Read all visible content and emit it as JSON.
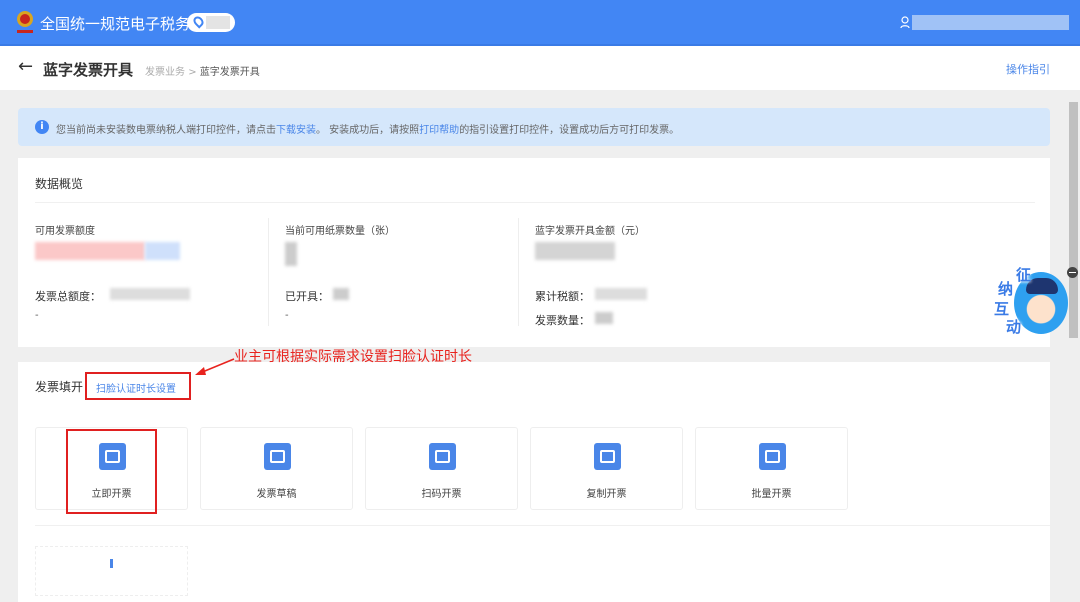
{
  "header": {
    "app_title": "全国统一规范电子税务局",
    "logo_icon": "tax-emblem-icon",
    "location_icon": "location-pin-icon",
    "user_icon": "user-icon",
    "brand_color": "#4286f4"
  },
  "subheader": {
    "back_icon": "←",
    "title": "蓝字发票开具",
    "breadcrumb": [
      "发票业务",
      "蓝字发票开具"
    ],
    "breadcrumb_sep": ">",
    "guide_link": "操作指引"
  },
  "notice": {
    "icon": "i",
    "text_1": "您当前尚未安装数电票纳税人端打印控件，请点击",
    "link_1": "下载安装",
    "text_2": "。 安装成功后，请按照",
    "link_2": "打印帮助",
    "text_3": "的指引设置打印控件，设置成功后方可打印发票。"
  },
  "overview": {
    "title": "数据概览",
    "columns": [
      {
        "label": "可用发票额度",
        "sub_label": "发票总额度：",
        "sub_value": "-"
      },
      {
        "label": "当前可用纸票数量（张）",
        "sub_label": "已开具：",
        "sub_value": "-"
      },
      {
        "label": "蓝字发票开具金额（元）",
        "sub_label": "累计税额：",
        "sub_label_2": "发票数量："
      }
    ]
  },
  "invoice": {
    "title": "发票填开",
    "face_auth_link": "扫脸认证时长设置",
    "tiles": [
      {
        "label": "立即开票",
        "icon": "invoice-issue-icon"
      },
      {
        "label": "发票草稿",
        "icon": "draft-icon"
      },
      {
        "label": "扫码开票",
        "icon": "qr-code-icon"
      },
      {
        "label": "复制开票",
        "icon": "copy-invoice-icon"
      },
      {
        "label": "批量开票",
        "icon": "batch-invoice-icon"
      }
    ]
  },
  "annotation": {
    "text": "业主可根据实际需求设置扫脸认证时长",
    "color": "#e8231e"
  },
  "mascot": {
    "chars": [
      "征",
      "纳",
      "互",
      "动"
    ]
  }
}
